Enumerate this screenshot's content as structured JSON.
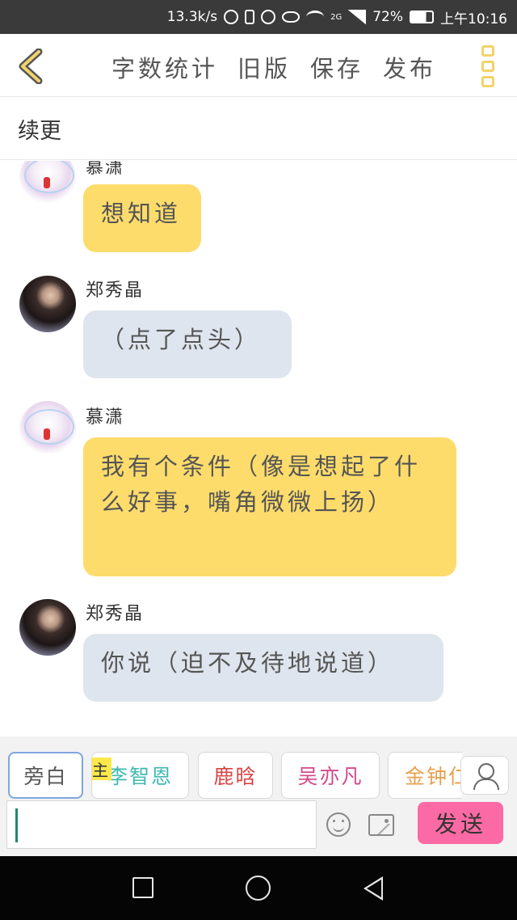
{
  "status_bar": {
    "net_speed": "13.3k/s",
    "network_type": "2G",
    "battery_percent": "72%",
    "time": "上午10:16",
    "icons": [
      "hd-icon",
      "vibrate-icon",
      "alarm-icon",
      "eye-icon",
      "wifi-icon",
      "signal-icon",
      "battery-icon"
    ]
  },
  "toolbar": {
    "back_icon": "chevron-left-icon",
    "word_count_label": "字数统计",
    "old_version_label": "旧版",
    "save_label": "保存",
    "publish_label": "发布",
    "menu_icon": "more-vertical-icon",
    "accent_color": "#f1d36b"
  },
  "chapter": {
    "title": "续更"
  },
  "messages": [
    {
      "speaker": "慕潇",
      "text": "想知道",
      "side": "left",
      "bubble_color": "#fddc6c",
      "avatar": "anime-avatar"
    },
    {
      "speaker": "郑秀晶",
      "text": "（点了点头）",
      "side": "left",
      "bubble_color": "#dfe5ee",
      "avatar": "photo-avatar"
    },
    {
      "speaker": "慕潇",
      "text": "我有个条件（像是想起了什么好事，嘴角微微上扬）",
      "side": "left",
      "bubble_color": "#fddc6c",
      "avatar": "anime-avatar"
    },
    {
      "speaker": "郑秀晶",
      "text": "你说（迫不及待地说道）",
      "side": "left",
      "bubble_color": "#dfe5ee",
      "avatar": "photo-avatar"
    }
  ],
  "cast": {
    "items": [
      {
        "label": "旁白",
        "color": "#555555",
        "selected": true
      },
      {
        "label": "李智恩",
        "color": "#3fb9b2",
        "tag": "主"
      },
      {
        "label": "鹿晗",
        "color": "#d94545"
      },
      {
        "label": "吴亦凡",
        "color": "#d24a8a"
      },
      {
        "label": "金钟仁",
        "color": "#e8a050"
      }
    ],
    "person_icon": "person-icon"
  },
  "composer": {
    "input_value": "",
    "emoji_icon": "emoji-icon",
    "image_icon": "image-icon",
    "send_label": "发送",
    "send_color": "#fb6aa4"
  },
  "nav_bar": {
    "icons": [
      "recent-apps-icon",
      "home-icon",
      "back-icon"
    ]
  }
}
